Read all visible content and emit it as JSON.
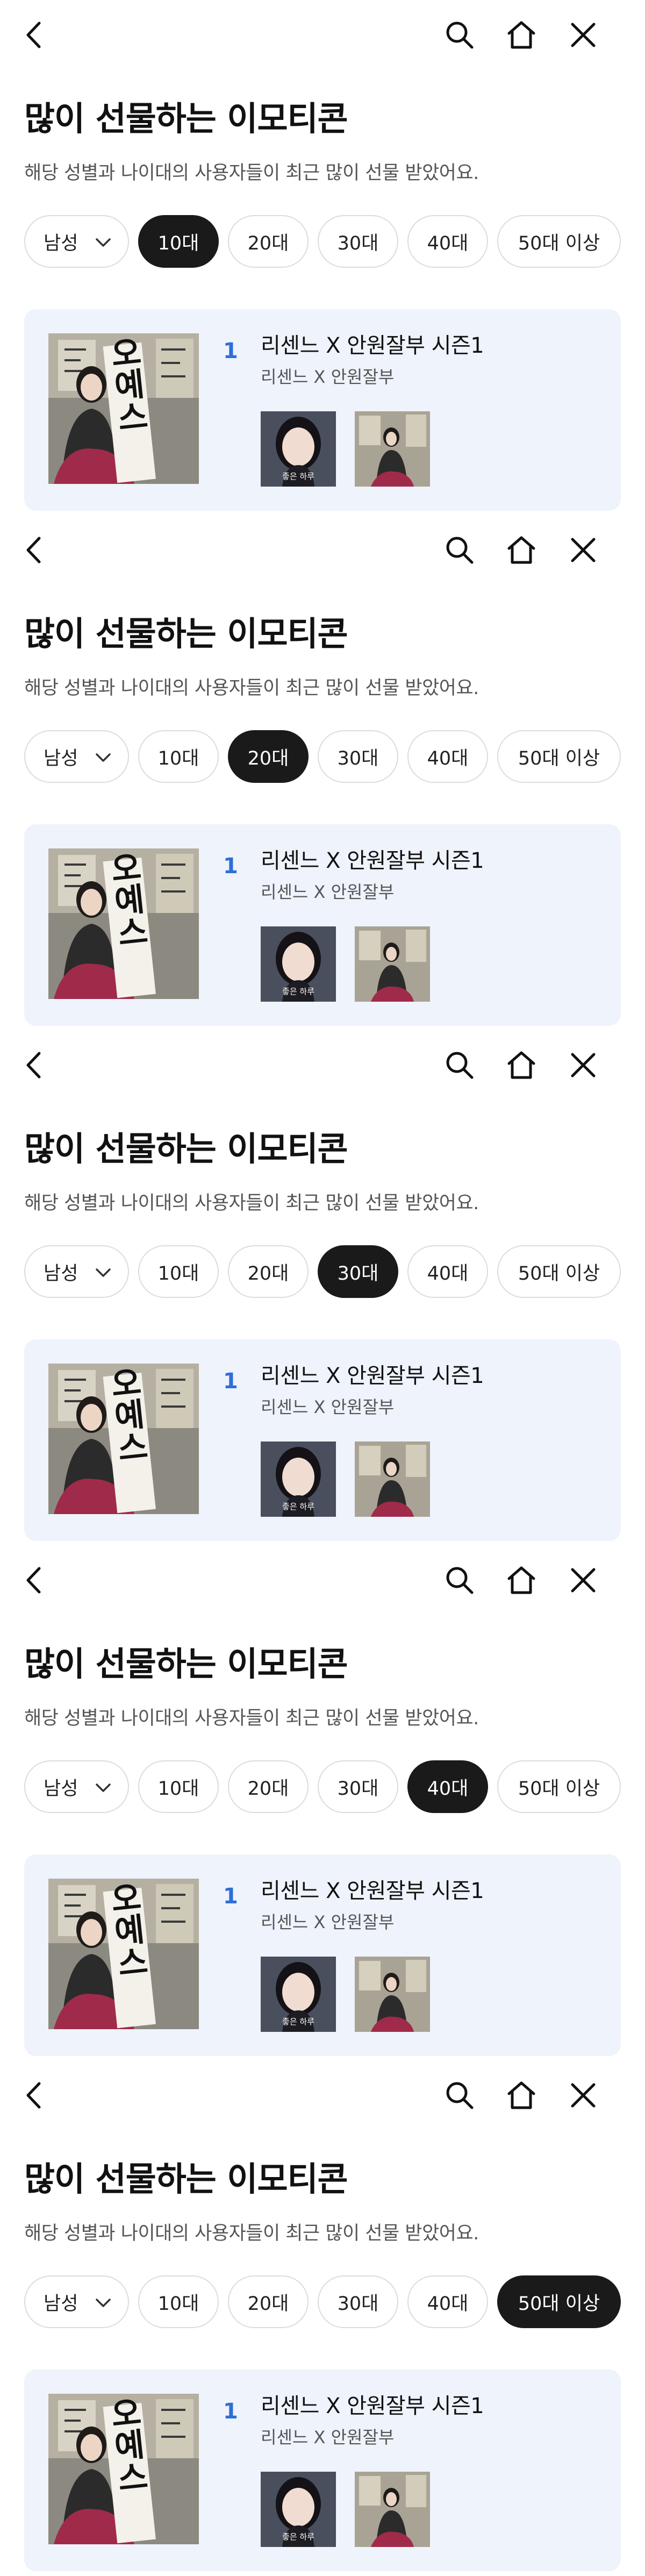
{
  "header": {
    "title": "많이 선물하는 이모티콘",
    "subtitle": "해당 성별과 나이대의 사용자들이 최근 많이 선물 받았어요."
  },
  "filters": {
    "gender": "남성",
    "ages": [
      "10대",
      "20대",
      "30대",
      "40대",
      "50대 이상"
    ]
  },
  "item": {
    "rank": "1",
    "title": "리센느 X 안원잘부 시즌1",
    "author": "리센느 X 안원잘부",
    "poster_text": "오예스",
    "sticker_caption": "좋은 하루"
  },
  "screens": [
    {
      "selected_age": "10대"
    },
    {
      "selected_age": "20대"
    },
    {
      "selected_age": "30대"
    },
    {
      "selected_age": "40대"
    },
    {
      "selected_age": "50대 이상"
    }
  ],
  "colors": {
    "accent": "#2f6fd6",
    "chip_active": "#1a1a1a",
    "card_bg": "#eef3fc",
    "hanbok_skirt": "#a02a4a"
  },
  "icons": [
    "chevron-left-icon",
    "search-icon",
    "home-icon",
    "close-icon",
    "chevron-down-icon"
  ]
}
